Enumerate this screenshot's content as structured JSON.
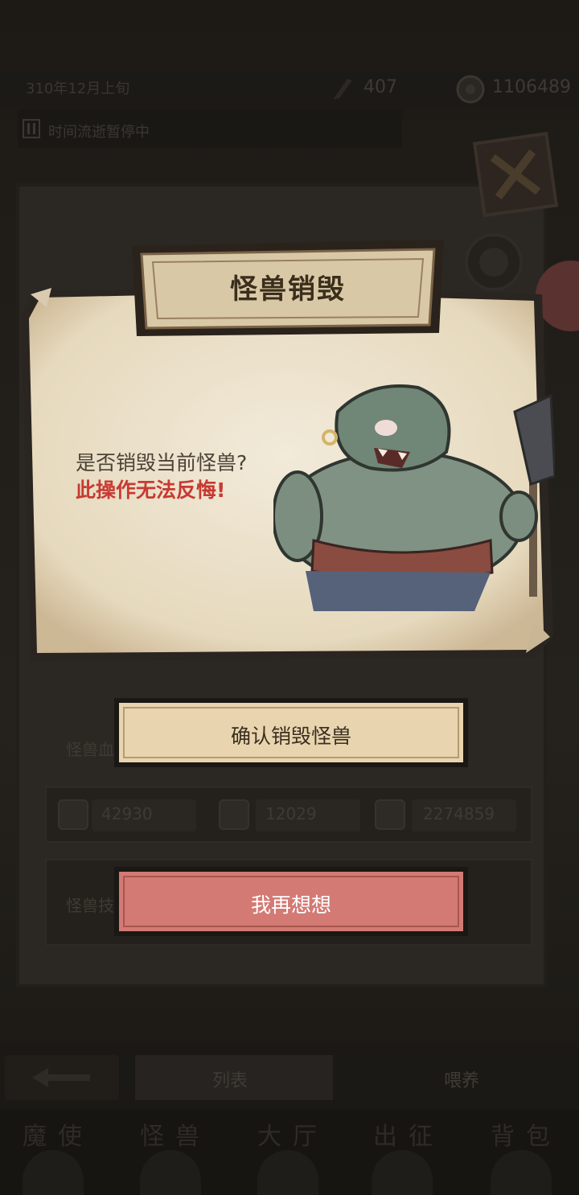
{
  "status_bar": {
    "date": "310年12月上旬",
    "quill_count": "407",
    "gold_count": "1106489",
    "pause_text": "时间流逝暂停中"
  },
  "dialog": {
    "title": "怪兽销毁",
    "question": "是否销毁当前怪兽?",
    "warning": "此操作无法反悔!",
    "confirm_label": "确认销毁怪兽",
    "cancel_label": "我再想想"
  },
  "background_panel": {
    "section_label_1": "怪兽血",
    "section_label_2": "怪兽技",
    "stats": [
      {
        "icon": "paw-icon",
        "value": "42930"
      },
      {
        "icon": "shield-icon",
        "value": "12029"
      },
      {
        "icon": "heart-icon",
        "value": "2274859"
      }
    ]
  },
  "sub_tabs": {
    "list_label": "列表",
    "feed_label": "喂养"
  },
  "bottom_nav": [
    {
      "label": "魔使",
      "icon": "skull-icon"
    },
    {
      "label": "怪兽",
      "icon": "monster-icon"
    },
    {
      "label": "大厅",
      "icon": "hall-icon"
    },
    {
      "label": "出征",
      "icon": "expedition-icon"
    },
    {
      "label": "背包",
      "icon": "bag-icon"
    }
  ],
  "colors": {
    "confirm_button": "#e8d4ae",
    "cancel_button": "#d37a74",
    "warning_text": "#c73a32",
    "paper": "#efe6d2"
  }
}
